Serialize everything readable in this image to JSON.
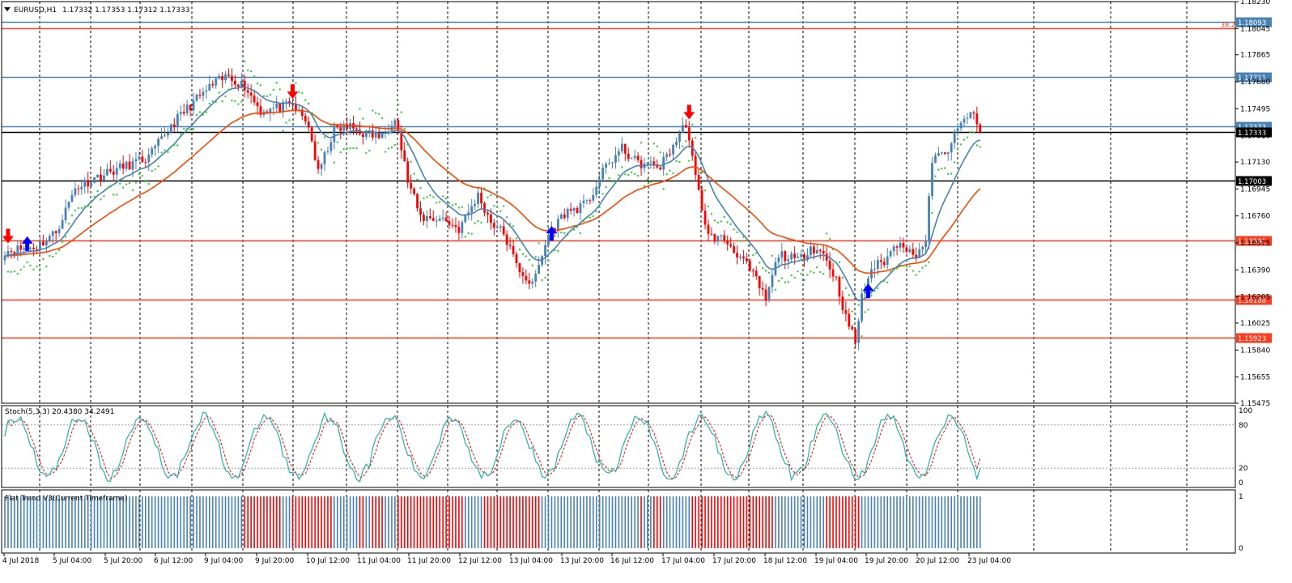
{
  "header": {
    "symbol": "EURUSD,H1",
    "ohlc": "1.17332 1.17353 1.17312 1.17333",
    "menu_icon": "triangle-down-icon"
  },
  "chart_data": {
    "type": "candlestick",
    "symbol": "EURUSD",
    "timeframe": "H1",
    "price_ylim": [
      1.15475,
      1.1823
    ],
    "price_ticks": [
      "1.18230",
      "1.18045",
      "1.17865",
      "1.17680",
      "1.17495",
      "1.17310",
      "1.17130",
      "1.16945",
      "1.16760",
      "1.16575",
      "1.16390",
      "1.16205",
      "1.16025",
      "1.15840",
      "1.15655",
      "1.15475"
    ],
    "x_labels": [
      "4 Jul 2018",
      "5 Jul 04:00",
      "5 Jul 20:00",
      "6 Jul 12:00",
      "9 Jul 04:00",
      "9 Jul 20:00",
      "10 Jul 12:00",
      "11 Jul 04:00",
      "11 Jul 20:00",
      "12 Jul 12:00",
      "13 Jul 04:00",
      "13 Jul 20:00",
      "16 Jul 12:00",
      "17 Jul 04:00",
      "17 Jul 20:00",
      "18 Jul 12:00",
      "19 Jul 04:00",
      "19 Jul 20:00",
      "20 Jul 12:00",
      "23 Jul 04:00"
    ],
    "horizontal_levels": [
      {
        "value": 1.18093,
        "label": "1.18093",
        "color": "#4682b4"
      },
      {
        "value": 1.18045,
        "label": "38.2",
        "color": "#ff3b1f"
      },
      {
        "value": 1.17711,
        "label": "1.17711",
        "color": "#4682b4"
      },
      {
        "value": 1.17373,
        "label": "1.17373",
        "color": "#4682b4"
      },
      {
        "value": 1.17333,
        "label": "1.17333",
        "color": "#000000"
      },
      {
        "value": 1.17003,
        "label": "1.17003",
        "color": "#000000"
      },
      {
        "value": 1.16591,
        "label": "1.16591",
        "color": "#ff3b1f"
      },
      {
        "value": 1.16188,
        "label": "1.16188",
        "color": "#ff3b1f"
      },
      {
        "value": 1.15923,
        "label": "1.15923",
        "color": "#ff3b1f"
      }
    ],
    "anchors": [
      {
        "t": 0,
        "p": 1.1652
      },
      {
        "t": 10,
        "p": 1.1655
      },
      {
        "t": 16,
        "p": 1.1665
      },
      {
        "t": 22,
        "p": 1.1695
      },
      {
        "t": 28,
        "p": 1.1702
      },
      {
        "t": 35,
        "p": 1.1708
      },
      {
        "t": 45,
        "p": 1.1716
      },
      {
        "t": 52,
        "p": 1.1738
      },
      {
        "t": 58,
        "p": 1.1752
      },
      {
        "t": 65,
        "p": 1.1766
      },
      {
        "t": 70,
        "p": 1.1772
      },
      {
        "t": 75,
        "p": 1.1765
      },
      {
        "t": 80,
        "p": 1.1748
      },
      {
        "t": 90,
        "p": 1.1752
      },
      {
        "t": 95,
        "p": 1.1738
      },
      {
        "t": 98,
        "p": 1.1705
      },
      {
        "t": 103,
        "p": 1.1735
      },
      {
        "t": 108,
        "p": 1.1737
      },
      {
        "t": 112,
        "p": 1.1733
      },
      {
        "t": 118,
        "p": 1.173
      },
      {
        "t": 122,
        "p": 1.1745
      },
      {
        "t": 126,
        "p": 1.17
      },
      {
        "t": 130,
        "p": 1.1675
      },
      {
        "t": 137,
        "p": 1.1674
      },
      {
        "t": 142,
        "p": 1.1667
      },
      {
        "t": 148,
        "p": 1.169
      },
      {
        "t": 152,
        "p": 1.1672
      },
      {
        "t": 156,
        "p": 1.1664
      },
      {
        "t": 160,
        "p": 1.1642
      },
      {
        "t": 165,
        "p": 1.1628
      },
      {
        "t": 170,
        "p": 1.1663
      },
      {
        "t": 175,
        "p": 1.1678
      },
      {
        "t": 182,
        "p": 1.1684
      },
      {
        "t": 188,
        "p": 1.171
      },
      {
        "t": 193,
        "p": 1.1722
      },
      {
        "t": 198,
        "p": 1.1712
      },
      {
        "t": 205,
        "p": 1.171
      },
      {
        "t": 210,
        "p": 1.1728
      },
      {
        "t": 213,
        "p": 1.174
      },
      {
        "t": 216,
        "p": 1.1702
      },
      {
        "t": 220,
        "p": 1.1662
      },
      {
        "t": 225,
        "p": 1.166
      },
      {
        "t": 230,
        "p": 1.1648
      },
      {
        "t": 235,
        "p": 1.1632
      },
      {
        "t": 238,
        "p": 1.1618
      },
      {
        "t": 242,
        "p": 1.165
      },
      {
        "t": 248,
        "p": 1.1645
      },
      {
        "t": 252,
        "p": 1.1655
      },
      {
        "t": 256,
        "p": 1.165
      },
      {
        "t": 260,
        "p": 1.1632
      },
      {
        "t": 263,
        "p": 1.1606
      },
      {
        "t": 266,
        "p": 1.159
      },
      {
        "t": 268,
        "p": 1.162
      },
      {
        "t": 271,
        "p": 1.164
      },
      {
        "t": 275,
        "p": 1.1645
      },
      {
        "t": 280,
        "p": 1.166
      },
      {
        "t": 284,
        "p": 1.1648
      },
      {
        "t": 288,
        "p": 1.1658
      },
      {
        "t": 290,
        "p": 1.1715
      },
      {
        "t": 294,
        "p": 1.1718
      },
      {
        "t": 298,
        "p": 1.1735
      },
      {
        "t": 302,
        "p": 1.1748
      },
      {
        "t": 305,
        "p": 1.1733
      }
    ],
    "indicators": [
      {
        "name": "Stoch(5,3,3)",
        "values": "20.4380 34.2491",
        "levels": [
          80,
          20
        ],
        "ylim": [
          0,
          100
        ],
        "tick_labels": [
          "100",
          "80",
          "20",
          "0"
        ]
      },
      {
        "name": "Flat Trend V3(Current Timeframe)",
        "ylim": [
          0,
          1
        ],
        "tick_labels": [
          "1",
          "0"
        ]
      }
    ],
    "arrows": [
      {
        "dir": "down",
        "t": 1
      },
      {
        "dir": "up",
        "t": 7
      },
      {
        "dir": "down",
        "t": 90
      },
      {
        "dir": "up",
        "t": 171
      },
      {
        "dir": "down",
        "t": 214
      },
      {
        "dir": "up",
        "t": 270
      }
    ],
    "colors": {
      "bull": "#4682b4",
      "bear": "#ff0000",
      "ma_fast": "#4682b4",
      "ma_slow": "#ff4500",
      "psar": "#32cd32",
      "stoch_main": "#20b2aa",
      "stoch_signal": "#ff0000",
      "grid": "#000000"
    }
  }
}
